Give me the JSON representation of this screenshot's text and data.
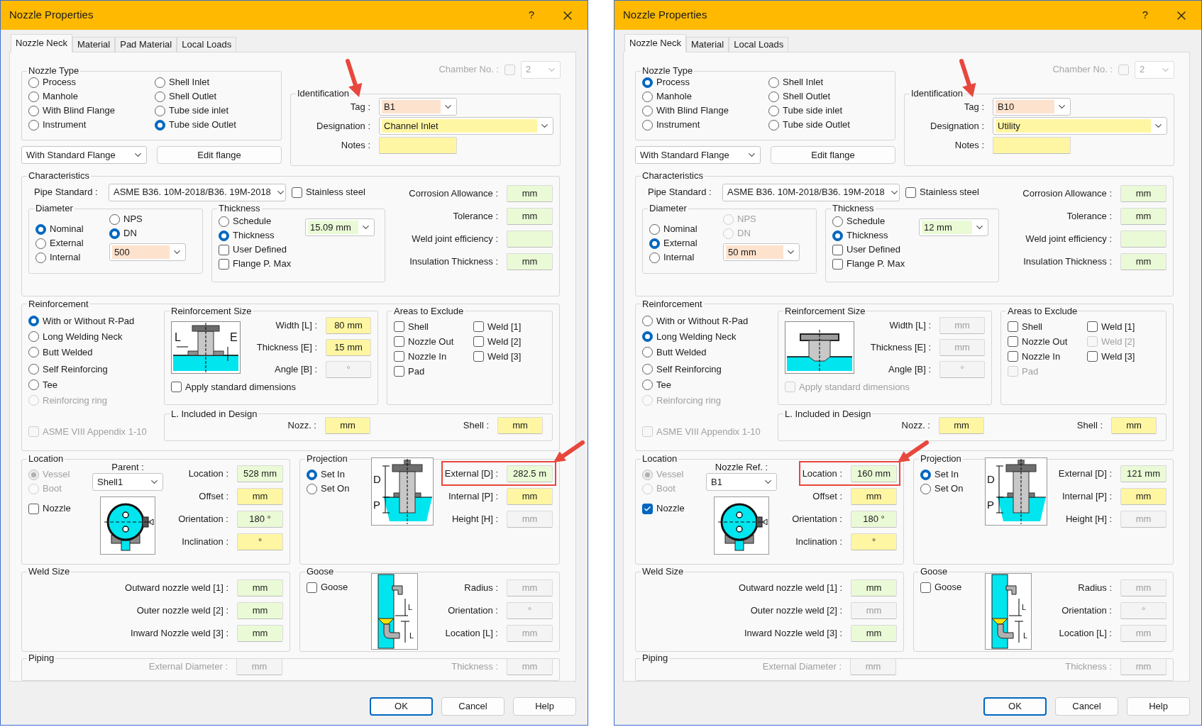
{
  "dialogs": [
    {
      "title": "Nozzle Properties",
      "help": "?",
      "tabs": [
        {
          "label": "Nozzle Neck",
          "selected": true
        },
        {
          "label": "Material",
          "selected": false
        },
        {
          "label": "Pad Material",
          "selected": false
        },
        {
          "label": "Local Loads",
          "selected": false
        }
      ],
      "chamber": {
        "label": "Chamber No. :",
        "checked": false,
        "disabled": true,
        "value": "2"
      },
      "nozzle_type": {
        "title": "Nozzle Type",
        "columns": [
          [
            {
              "label": "Process",
              "selected": false
            },
            {
              "label": "Manhole",
              "selected": false
            },
            {
              "label": "With Blind Flange",
              "selected": false
            },
            {
              "label": "Instrument",
              "selected": false
            }
          ],
          [
            {
              "label": "Shell Inlet",
              "selected": false
            },
            {
              "label": "Shell Outlet",
              "selected": false
            },
            {
              "label": "Tube side inlet",
              "selected": false
            },
            {
              "label": "Tube side Outlet",
              "selected": true
            }
          ]
        ]
      },
      "flange": {
        "value": "With Standard Flange"
      },
      "edit_flange": "Edit flange",
      "identification": {
        "title": "Identification",
        "fields": [
          {
            "label": "Tag :",
            "value": "B1",
            "kind": "key",
            "combo": true,
            "arrow": true
          },
          {
            "label": "Designation :",
            "value": "Channel Inlet",
            "kind": "required",
            "combo": true
          },
          {
            "label": "Notes :",
            "kind": "required",
            "combo": false
          }
        ]
      },
      "characteristics": {
        "title": "Characteristics",
        "pipe_standard": {
          "label": "Pipe Standard :",
          "value": "ASME B36. 10M-2018/B36. 19M-2018"
        },
        "stainless": {
          "label": "Stainless steel",
          "checked": false
        },
        "diameter": {
          "title": "Diameter",
          "options": [
            {
              "label": "Nominal",
              "selected": true
            },
            {
              "label": "External",
              "selected": false
            },
            {
              "label": "Internal",
              "selected": false
            }
          ],
          "units": [
            {
              "label": "NPS",
              "selected": false,
              "disabled": false
            },
            {
              "label": "DN",
              "selected": true,
              "disabled": false
            }
          ],
          "size": {
            "value": "500",
            "kind": "key"
          }
        },
        "thickness": {
          "title": "Thickness",
          "options": [
            {
              "label": "Schedule",
              "selected": false
            },
            {
              "label": "Thickness",
              "selected": true
            }
          ],
          "checks": [
            {
              "label": "User Defined",
              "checked": false
            },
            {
              "label": "Flange P. Max",
              "checked": false
            }
          ],
          "value": {
            "value": "15.09 mm",
            "kind": "entered"
          }
        },
        "fields": [
          {
            "label": "Corrosion Allowance :",
            "value": "mm",
            "kind": "entered"
          },
          {
            "label": "Tolerance :",
            "value": "mm",
            "kind": "entered"
          },
          {
            "label": "Weld joint efficiency :",
            "kind": "entered"
          },
          {
            "label": "Insulation Thickness :",
            "value": "mm",
            "kind": "entered"
          }
        ]
      },
      "reinforcement": {
        "title": "Reinforcement",
        "options": [
          {
            "label": "With or Without R-Pad",
            "selected": true,
            "disabled": false
          },
          {
            "label": "Long Welding Neck",
            "selected": false,
            "disabled": false
          },
          {
            "label": "Butt Welded",
            "selected": false,
            "disabled": false
          },
          {
            "label": "Self Reinforcing",
            "selected": false,
            "disabled": false
          },
          {
            "label": "Tee",
            "selected": false,
            "disabled": false
          },
          {
            "label": "Reinforcing ring",
            "selected": false,
            "disabled": true
          }
        ],
        "asme": {
          "label": "ASME VIII Appendix 1-10",
          "checked": false,
          "disabled": true
        },
        "size": {
          "title": "Reinforcement Size",
          "drawing": {
            "kind": "pad",
            "labels": [
              "L",
              "E"
            ]
          },
          "fields": [
            {
              "label": "Width [L] :",
              "value": "80 mm",
              "kind": "required"
            },
            {
              "label": "Thickness [E] :",
              "value": "15 mm",
              "kind": "required"
            },
            {
              "label": "Angle [B] :",
              "value": "°",
              "kind": "disabled"
            }
          ],
          "apply": {
            "label": "Apply standard dimensions",
            "checked": false,
            "disabled": false
          }
        },
        "exclude": {
          "title": "Areas to Exclude",
          "columns": [
            [
              {
                "label": "Shell",
                "checked": false,
                "disabled": false
              },
              {
                "label": "Nozzle Out",
                "checked": false,
                "disabled": false
              },
              {
                "label": "Nozzle In",
                "checked": false,
                "disabled": false
              },
              {
                "label": "Pad",
                "checked": false,
                "disabled": false
              }
            ],
            [
              {
                "label": "Weld [1]",
                "checked": false,
                "disabled": false
              },
              {
                "label": "Weld [2]",
                "checked": false,
                "disabled": false
              },
              {
                "label": "Weld [3]",
                "checked": false,
                "disabled": false
              }
            ]
          ]
        },
        "included": {
          "title": "L. Included in Design",
          "fields": [
            {
              "label": "Nozz. :",
              "value": "mm",
              "kind": "required"
            },
            {
              "label": "Shell :",
              "value": "mm",
              "kind": "required"
            }
          ]
        }
      },
      "location": {
        "title": "Location",
        "options": [
          {
            "label": "Vessel",
            "selected": true,
            "disabled": true
          },
          {
            "label": "Boot",
            "selected": false,
            "disabled": true
          }
        ],
        "nozzle": {
          "label": "Nozzle",
          "checked": false
        },
        "parent": {
          "label": "Parent :",
          "value": "Shell1"
        },
        "fields": [
          {
            "label": "Location :",
            "value": "528 mm",
            "kind": "entered"
          },
          {
            "label": "Offset :",
            "value": "mm",
            "kind": "required"
          },
          {
            "label": "Orientation :",
            "value": "180 °",
            "kind": "entered"
          },
          {
            "label": "Inclination :",
            "value": "°",
            "kind": "required"
          }
        ]
      },
      "projection": {
        "title": "Projection",
        "options": [
          {
            "label": "Set In",
            "selected": true
          },
          {
            "label": "Set On",
            "selected": false
          }
        ],
        "drawing": {
          "labels": [
            "D",
            "P"
          ]
        },
        "fields": [
          {
            "label": "External [D] :",
            "value": "282.5 m",
            "kind": "entered",
            "highlight": true,
            "arrow": true
          },
          {
            "label": "Internal [P] :",
            "value": "mm",
            "kind": "required"
          },
          {
            "label": "Height [H] :",
            "value": "mm",
            "kind": "disabled"
          }
        ]
      },
      "weld_size": {
        "title": "Weld Size",
        "fields": [
          {
            "label": "Outward nozzle weld [1] :",
            "value": "mm",
            "kind": "entered"
          },
          {
            "label": "Outer nozzle weld [2] :",
            "value": "mm",
            "kind": "entered"
          },
          {
            "label": "Inward Nozzle weld [3] :",
            "value": "mm",
            "kind": "entered"
          }
        ]
      },
      "goose": {
        "title": "Goose",
        "check": {
          "label": "Goose",
          "checked": false
        },
        "drawing": {
          "labels": [
            "L",
            "L"
          ]
        },
        "fields": [
          {
            "label": "Radius :",
            "value": "mm",
            "kind": "disabled"
          },
          {
            "label": "Orientation :",
            "value": "°",
            "kind": "disabled"
          },
          {
            "label": "Location [L] :",
            "value": "mm",
            "kind": "disabled"
          }
        ]
      },
      "piping": {
        "title": "Piping",
        "disabled": true,
        "fields": [
          {
            "label": "External Diameter :",
            "value": "mm",
            "kind": "disabled"
          },
          {
            "label": "Thickness :",
            "value": "mm",
            "kind": "disabled"
          }
        ]
      },
      "buttons": [
        {
          "label": "OK",
          "default": true
        },
        {
          "label": "Cancel",
          "default": false
        },
        {
          "label": "Help",
          "default": false
        }
      ]
    },
    {
      "title": "Nozzle Properties",
      "help": "?",
      "tabs": [
        {
          "label": "Nozzle Neck",
          "selected": true
        },
        {
          "label": "Material",
          "selected": false
        },
        {
          "label": "Local Loads",
          "selected": false
        }
      ],
      "chamber": {
        "label": "Chamber No. :",
        "checked": false,
        "disabled": true,
        "value": "2"
      },
      "nozzle_type": {
        "title": "Nozzle Type",
        "columns": [
          [
            {
              "label": "Process",
              "selected": true
            },
            {
              "label": "Manhole",
              "selected": false
            },
            {
              "label": "With Blind Flange",
              "selected": false
            },
            {
              "label": "Instrument",
              "selected": false
            }
          ],
          [
            {
              "label": "Shell Inlet",
              "selected": false
            },
            {
              "label": "Shell Outlet",
              "selected": false
            },
            {
              "label": "Tube side inlet",
              "selected": false
            },
            {
              "label": "Tube side Outlet",
              "selected": false
            }
          ]
        ]
      },
      "flange": {
        "value": "With Standard Flange"
      },
      "edit_flange": "Edit flange",
      "identification": {
        "title": "Identification",
        "fields": [
          {
            "label": "Tag :",
            "value": "B10",
            "kind": "key",
            "combo": true,
            "arrow": true
          },
          {
            "label": "Designation :",
            "value": "Utility",
            "kind": "required",
            "combo": true
          },
          {
            "label": "Notes :",
            "kind": "required",
            "combo": false
          }
        ]
      },
      "characteristics": {
        "title": "Characteristics",
        "pipe_standard": {
          "label": "Pipe Standard :",
          "value": "ASME B36. 10M-2018/B36. 19M-2018"
        },
        "stainless": {
          "label": "Stainless steel",
          "checked": false
        },
        "diameter": {
          "title": "Diameter",
          "options": [
            {
              "label": "Nominal",
              "selected": false
            },
            {
              "label": "External",
              "selected": true
            },
            {
              "label": "Internal",
              "selected": false
            }
          ],
          "units": [
            {
              "label": "NPS",
              "selected": false,
              "disabled": true
            },
            {
              "label": "DN",
              "selected": false,
              "disabled": true
            }
          ],
          "size": {
            "value": "50 mm",
            "kind": "key"
          }
        },
        "thickness": {
          "title": "Thickness",
          "options": [
            {
              "label": "Schedule",
              "selected": false
            },
            {
              "label": "Thickness",
              "selected": true
            }
          ],
          "checks": [
            {
              "label": "User Defined",
              "checked": false
            },
            {
              "label": "Flange P. Max",
              "checked": false
            }
          ],
          "value": {
            "value": "12 mm",
            "kind": "entered"
          }
        },
        "fields": [
          {
            "label": "Corrosion Allowance :",
            "value": "mm",
            "kind": "entered"
          },
          {
            "label": "Tolerance :",
            "value": "mm",
            "kind": "entered"
          },
          {
            "label": "Weld joint efficiency :",
            "kind": "entered"
          },
          {
            "label": "Insulation Thickness :",
            "value": "mm",
            "kind": "entered"
          }
        ]
      },
      "reinforcement": {
        "title": "Reinforcement",
        "options": [
          {
            "label": "With or Without R-Pad",
            "selected": false,
            "disabled": false
          },
          {
            "label": "Long Welding Neck",
            "selected": true,
            "disabled": false
          },
          {
            "label": "Butt Welded",
            "selected": false,
            "disabled": false
          },
          {
            "label": "Self Reinforcing",
            "selected": false,
            "disabled": false
          },
          {
            "label": "Tee",
            "selected": false,
            "disabled": false
          },
          {
            "label": "Reinforcing ring",
            "selected": false,
            "disabled": true
          }
        ],
        "asme": {
          "label": "ASME VIII Appendix 1-10",
          "checked": false,
          "disabled": true
        },
        "size": {
          "title": "Reinforcement Size",
          "drawing": {
            "kind": "neck"
          },
          "fields": [
            {
              "label": "Width [L] :",
              "value": "mm",
              "kind": "disabled"
            },
            {
              "label": "Thickness [E] :",
              "value": "mm",
              "kind": "disabled"
            },
            {
              "label": "Angle [B] :",
              "value": "°",
              "kind": "disabled"
            }
          ],
          "apply": {
            "label": "Apply standard dimensions",
            "checked": false,
            "disabled": true
          }
        },
        "exclude": {
          "title": "Areas to Exclude",
          "columns": [
            [
              {
                "label": "Shell",
                "checked": false,
                "disabled": false
              },
              {
                "label": "Nozzle Out",
                "checked": false,
                "disabled": false
              },
              {
                "label": "Nozzle In",
                "checked": false,
                "disabled": false
              },
              {
                "label": "Pad",
                "checked": false,
                "disabled": true
              }
            ],
            [
              {
                "label": "Weld [1]",
                "checked": false,
                "disabled": false
              },
              {
                "label": "Weld [2]",
                "checked": false,
                "disabled": true
              },
              {
                "label": "Weld [3]",
                "checked": false,
                "disabled": false
              }
            ]
          ]
        },
        "included": {
          "title": "L. Included in Design",
          "fields": [
            {
              "label": "Nozz. :",
              "value": "mm",
              "kind": "required"
            },
            {
              "label": "Shell :",
              "value": "mm",
              "kind": "required"
            }
          ]
        }
      },
      "location": {
        "title": "Location",
        "options": [
          {
            "label": "Vessel",
            "selected": true,
            "disabled": true
          },
          {
            "label": "Boot",
            "selected": false,
            "disabled": true
          }
        ],
        "nozzle": {
          "label": "Nozzle",
          "checked": true
        },
        "parent": {
          "label": "Nozzle Ref. :",
          "value": "B1"
        },
        "fields": [
          {
            "label": "Location :",
            "value": "160 mm",
            "kind": "entered",
            "highlight": true,
            "arrow": true
          },
          {
            "label": "Offset :",
            "value": "mm",
            "kind": "required"
          },
          {
            "label": "Orientation :",
            "value": "180 °",
            "kind": "entered"
          },
          {
            "label": "Inclination :",
            "value": "°",
            "kind": "required"
          }
        ]
      },
      "projection": {
        "title": "Projection",
        "options": [
          {
            "label": "Set In",
            "selected": true
          },
          {
            "label": "Set On",
            "selected": false
          }
        ],
        "drawing": {
          "labels": [
            "D",
            "P"
          ]
        },
        "fields": [
          {
            "label": "External [D] :",
            "value": "121 mm",
            "kind": "entered"
          },
          {
            "label": "Internal [P] :",
            "value": "mm",
            "kind": "required"
          },
          {
            "label": "Height [H] :",
            "value": "mm",
            "kind": "disabled"
          }
        ]
      },
      "weld_size": {
        "title": "Weld Size",
        "fields": [
          {
            "label": "Outward nozzle weld [1] :",
            "value": "mm",
            "kind": "entered"
          },
          {
            "label": "Outer nozzle weld [2] :",
            "value": "mm",
            "kind": "disabled"
          },
          {
            "label": "Inward Nozzle weld [3] :",
            "value": "mm",
            "kind": "entered"
          }
        ]
      },
      "goose": {
        "title": "Goose",
        "check": {
          "label": "Goose",
          "checked": false
        },
        "drawing": {
          "labels": [
            "L",
            "L"
          ]
        },
        "fields": [
          {
            "label": "Radius :",
            "value": "mm",
            "kind": "disabled"
          },
          {
            "label": "Orientation :",
            "value": "°",
            "kind": "disabled"
          },
          {
            "label": "Location [L] :",
            "value": "mm",
            "kind": "disabled"
          }
        ]
      },
      "piping": {
        "title": "Piping",
        "disabled": true,
        "fields": [
          {
            "label": "External Diameter :",
            "value": "mm",
            "kind": "disabled"
          },
          {
            "label": "Thickness :",
            "value": "mm",
            "kind": "disabled"
          }
        ]
      },
      "buttons": [
        {
          "label": "OK",
          "default": true
        },
        {
          "label": "Cancel",
          "default": false
        },
        {
          "label": "Help",
          "default": false
        }
      ]
    }
  ]
}
